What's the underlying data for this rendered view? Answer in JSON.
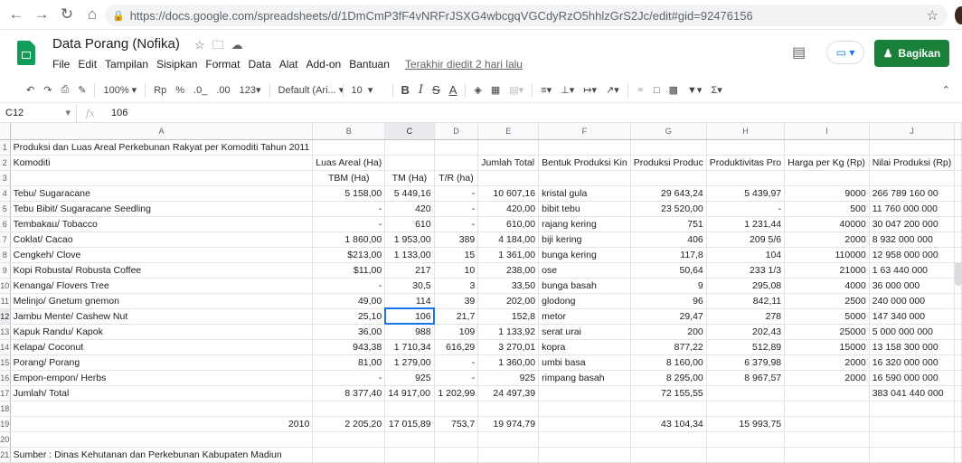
{
  "browser": {
    "url": "https://docs.google.com/spreadsheets/d/1DmCmP3fF4vNRFrJSXG4wbcgqVGCdyRzO5hhlzGrS2Jc/edit#gid=92476156"
  },
  "app": {
    "title": "Data Porang (Nofika)",
    "menus": [
      "File",
      "Edit",
      "Tampilan",
      "Sisipkan",
      "Format",
      "Data",
      "Alat",
      "Add-on",
      "Bantuan"
    ],
    "last_edit": "Terakhir diedit 2 hari lalu",
    "share_label": "Bagikan"
  },
  "toolbar": {
    "zoom": "100%",
    "currency": "Rp",
    "percent": "%",
    "dec_less": ".0_",
    "dec_more": ".00",
    "more_formats": "123",
    "font": "Default (Ari...",
    "font_size": "10",
    "bold": "B",
    "italic": "I",
    "strike": "S",
    "textcolor": "A"
  },
  "formula_bar": {
    "cell_ref": "C12",
    "fx": "fx",
    "value": "106"
  },
  "sheet": {
    "columns": [
      "A",
      "B",
      "C",
      "D",
      "E",
      "F",
      "G",
      "H",
      "I",
      "J"
    ],
    "rows": [
      {
        "n": "1",
        "cells": [
          "Produksi dan Luas Areal Perkebunan Rakyat per Komoditi Tahun 2011",
          "",
          "",
          "",
          "",
          "",
          "",
          "",
          "",
          ""
        ]
      },
      {
        "n": "2",
        "cells": [
          "Komoditi",
          "Luas Areal (Ha)",
          "",
          "",
          "Jumlah      Total",
          "Bentuk Produksi Kin",
          "Produksi Produc",
          "Produktivitas Pro",
          "Harga per Kg (Rp)",
          "Nilai Produksi (Rp)"
        ]
      },
      {
        "n": "3",
        "cells": [
          "",
          "TBM (Ha)",
          "TM (Ha)",
          "T/R (ha)",
          "",
          "",
          "",
          "",
          "",
          ""
        ]
      },
      {
        "n": "4",
        "cells": [
          "Tebu/ Sugaracane",
          "5 158,00",
          "5 449,16",
          "-",
          "10 607,16",
          "kristal gula",
          "29 643,24",
          "5 439,97",
          "9000",
          "266 789 160 00"
        ]
      },
      {
        "n": "5",
        "cells": [
          "Tebu Bibit/ Sugaracane Seedling",
          "-",
          "420",
          "-",
          "420,00",
          "bibit tebu",
          "23 520,00",
          "-",
          "500",
          "11 760 000 000"
        ]
      },
      {
        "n": "6",
        "cells": [
          "Tembakau/ Tobacco",
          "-",
          "610",
          "-",
          "610,00",
          "rajang kering",
          "751",
          "1 231,44",
          "40000",
          "30 047 200 000"
        ]
      },
      {
        "n": "7",
        "cells": [
          "Coklat/ Cacao",
          "1 860,00",
          "1 953,00",
          "389",
          "4 184,00",
          "biji kering",
          "406",
          "209 5/6",
          "2000",
          "8 932 000 000"
        ]
      },
      {
        "n": "8",
        "cells": [
          "Cengkeh/ Clove",
          "$213,00",
          "1 133,00",
          "15",
          "1 361,00",
          "bunga kering",
          "117,8",
          "104",
          "110000",
          "12 958 000 000"
        ]
      },
      {
        "n": "9",
        "cells": [
          "Kopi Robusta/ Robusta Coffee",
          "$11,00",
          "217",
          "10",
          "238,00",
          "ose",
          "50,64",
          "233 1/3",
          "21000",
          "1 63 440 000"
        ]
      },
      {
        "n": "10",
        "cells": [
          "Kenanga/ Flovers Tree",
          "-",
          "30,5",
          "3",
          "33,50",
          "bunga basah",
          "9",
          "295,08",
          "4000",
          "36 000 000"
        ]
      },
      {
        "n": "11",
        "cells": [
          "Melinjo/ Gnetum gnemon",
          "49,00",
          "114",
          "39",
          "202,00",
          "glodong",
          "96",
          "842,11",
          "2500",
          "240 000 000"
        ]
      },
      {
        "n": "12",
        "cells": [
          "Jambu Mente/ Cashew Nut",
          "25,10",
          "106",
          "21,7",
          "152,8",
          "metor",
          "29,47",
          "278",
          "5000",
          "147 340 000"
        ]
      },
      {
        "n": "13",
        "cells": [
          "Kapuk Randu/ Kapok",
          "36,00",
          "988",
          "109",
          "1 133,92",
          "serat urai",
          "200",
          "202,43",
          "25000",
          "5 000 000 000"
        ]
      },
      {
        "n": "14",
        "cells": [
          "Kelapa/ Coconut",
          "943,38",
          "1 710,34",
          "616,29",
          "3 270,01",
          "kopra",
          "877,22",
          "512,89",
          "15000",
          "13 158 300 000"
        ]
      },
      {
        "n": "15",
        "cells": [
          "Porang/ Porang",
          "81,00",
          "1 279,00",
          "-",
          "1 360,00",
          "umbi basa",
          "8 160,00",
          "6 379,98",
          "2000",
          "16 320 000 000"
        ]
      },
      {
        "n": "16",
        "cells": [
          "Empon-empon/ Herbs",
          "-",
          "925",
          "-",
          "925",
          "rimpang basah",
          "8 295,00",
          "8 967,57",
          "2000",
          "16 590 000 000"
        ]
      },
      {
        "n": "17",
        "cells": [
          "Jumlah/ Total",
          "8 377,40",
          "14 917,00",
          "1 202,99",
          "24 497,39",
          "",
          "72 155,55",
          "",
          "",
          "383 041 440 000"
        ]
      },
      {
        "n": "18",
        "cells": [
          "",
          "",
          "",
          "",
          "",
          "",
          "",
          "",
          "",
          ""
        ]
      },
      {
        "n": "19",
        "cells": [
          "2010",
          "2 205,20",
          "17 015,89",
          "753,7",
          "19 974,79",
          "",
          "43 104,34",
          "15 993,75",
          "",
          ""
        ]
      },
      {
        "n": "20",
        "cells": [
          "",
          "",
          "",
          "",
          "",
          "",
          "",
          "",
          "",
          ""
        ]
      },
      {
        "n": "21",
        "cells": [
          "Sumber : Dinas Kehutanan dan Perkebunan Kabupaten Madiun",
          "",
          "",
          "",
          "",
          "",
          "",
          "",
          "",
          ""
        ]
      }
    ]
  }
}
